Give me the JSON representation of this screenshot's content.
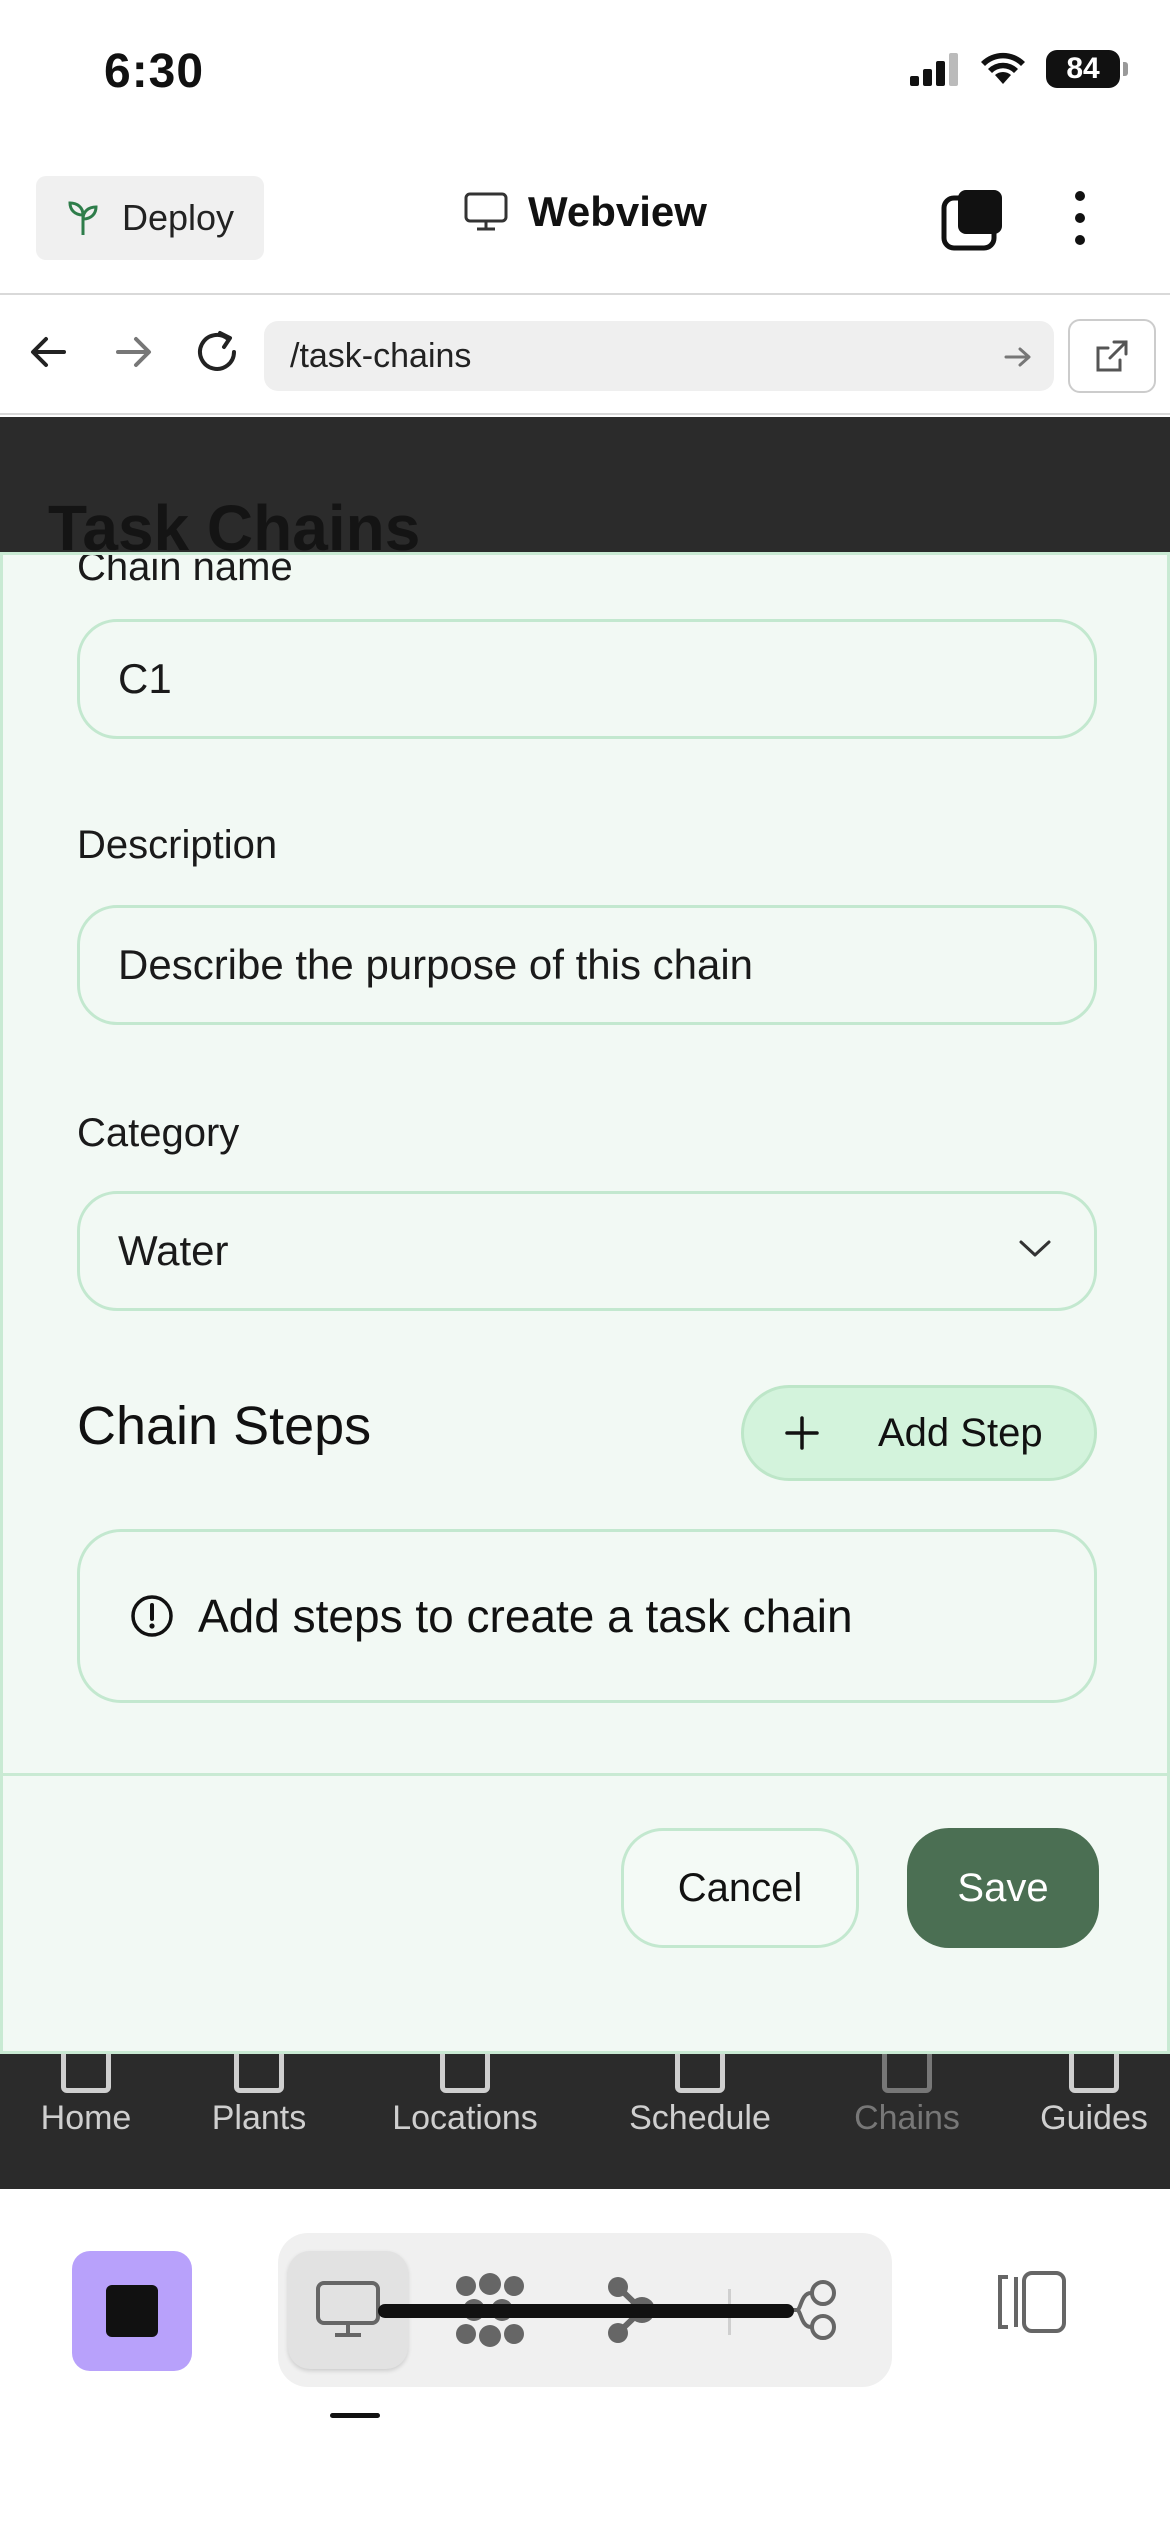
{
  "status_bar": {
    "time": "6:30",
    "battery": "84"
  },
  "header": {
    "deploy_label": "Deploy",
    "title": "Webview"
  },
  "browser": {
    "url": "/task-chains"
  },
  "page": {
    "title": "Task Chains",
    "bottom_nav": [
      {
        "label": "Home"
      },
      {
        "label": "Plants"
      },
      {
        "label": "Locations"
      },
      {
        "label": "Schedule"
      },
      {
        "label": "Chains",
        "active": true
      },
      {
        "label": "Guides"
      }
    ]
  },
  "modal": {
    "chain_name_label": "Chain name",
    "chain_name_value": "C1",
    "description_label": "Description",
    "description_placeholder": "Describe the purpose of this chain",
    "category_label": "Category",
    "category_value": "Water",
    "steps_title": "Chain Steps",
    "add_step_label": "Add Step",
    "empty_message": "Add steps to create a task chain",
    "cancel_label": "Cancel",
    "save_label": "Save"
  },
  "colors": {
    "modal_bg": "#f2f9f4",
    "modal_border": "#c9ead3",
    "save_bg": "#4b6f53",
    "add_step_bg": "#d3f3dc",
    "stop_bg": "#b8a1fb"
  },
  "icons": {
    "deploy": "sprout-icon",
    "webview": "monitor-icon",
    "empty_state": "alert-circle-icon",
    "select": "chevron-down-icon"
  }
}
